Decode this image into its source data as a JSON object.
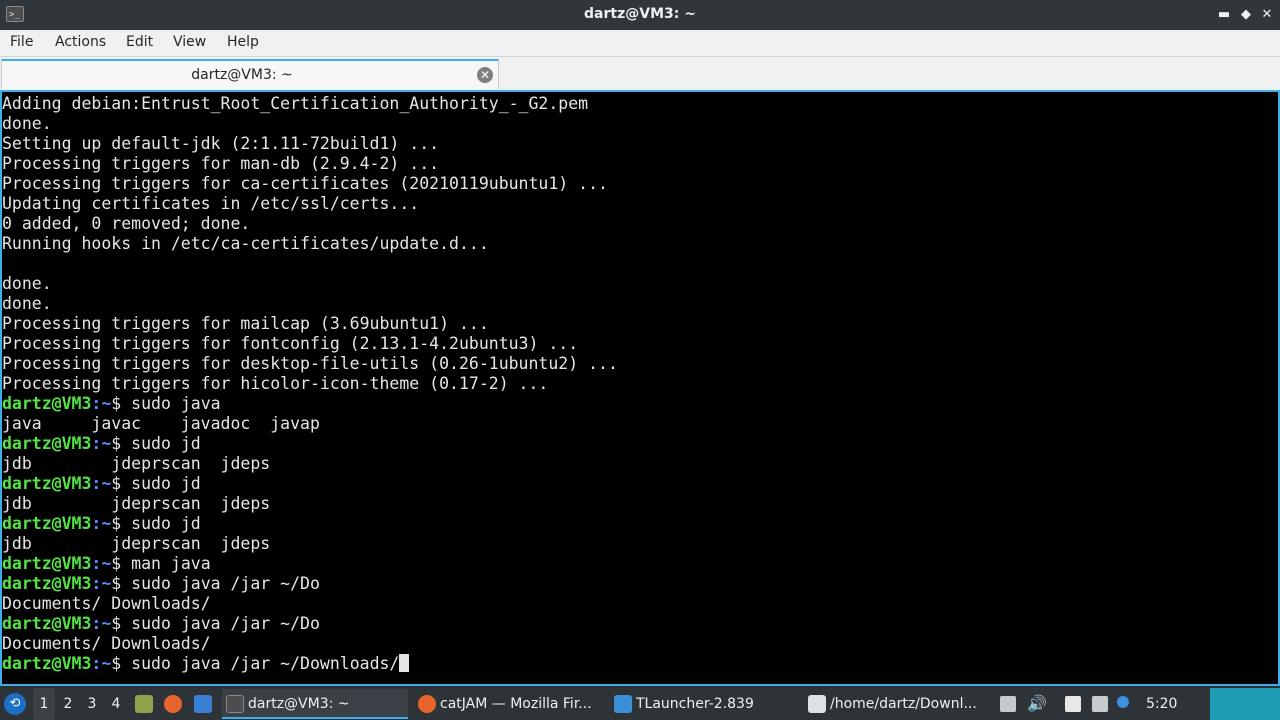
{
  "window": {
    "title": "dartz@VM3: ~",
    "app_icon": ">_",
    "minimize": "▬",
    "maximize": "◆",
    "close": "✕"
  },
  "menu": [
    "File",
    "Actions",
    "Edit",
    "View",
    "Help"
  ],
  "tab": {
    "label": "dartz@VM3: ~",
    "close": "✕"
  },
  "prompt": {
    "user_host": "dartz@VM3",
    "path": ":~",
    "symbol": "$ "
  },
  "terminal_lines": [
    {
      "type": "out",
      "text": "Adding debian:Entrust_Root_Certification_Authority_-_G2.pem"
    },
    {
      "type": "out",
      "text": "done."
    },
    {
      "type": "out",
      "text": "Setting up default-jdk (2:1.11-72build1) ..."
    },
    {
      "type": "out",
      "text": "Processing triggers for man-db (2.9.4-2) ..."
    },
    {
      "type": "out",
      "text": "Processing triggers for ca-certificates (20210119ubuntu1) ..."
    },
    {
      "type": "out",
      "text": "Updating certificates in /etc/ssl/certs..."
    },
    {
      "type": "out",
      "text": "0 added, 0 removed; done."
    },
    {
      "type": "out",
      "text": "Running hooks in /etc/ca-certificates/update.d..."
    },
    {
      "type": "out",
      "text": ""
    },
    {
      "type": "out",
      "text": "done."
    },
    {
      "type": "out",
      "text": "done."
    },
    {
      "type": "out",
      "text": "Processing triggers for mailcap (3.69ubuntu1) ..."
    },
    {
      "type": "out",
      "text": "Processing triggers for fontconfig (2.13.1-4.2ubuntu3) ..."
    },
    {
      "type": "out",
      "text": "Processing triggers for desktop-file-utils (0.26-1ubuntu2) ..."
    },
    {
      "type": "out",
      "text": "Processing triggers for hicolor-icon-theme (0.17-2) ..."
    },
    {
      "type": "cmd",
      "text": "sudo java"
    },
    {
      "type": "out",
      "text": "java     javac    javadoc  javap"
    },
    {
      "type": "cmd",
      "text": "sudo jd"
    },
    {
      "type": "out",
      "text": "jdb        jdeprscan  jdeps"
    },
    {
      "type": "cmd",
      "text": "sudo jd"
    },
    {
      "type": "out",
      "text": "jdb        jdeprscan  jdeps"
    },
    {
      "type": "cmd",
      "text": "sudo jd"
    },
    {
      "type": "out",
      "text": "jdb        jdeprscan  jdeps"
    },
    {
      "type": "cmd",
      "text": "man java"
    },
    {
      "type": "cmd",
      "text": "sudo java /jar ~/Do"
    },
    {
      "type": "out",
      "text": "Documents/ Downloads/"
    },
    {
      "type": "cmd",
      "text": "sudo java /jar ~/Do"
    },
    {
      "type": "out",
      "text": "Documents/ Downloads/"
    },
    {
      "type": "cmd",
      "text": "sudo java /jar ~/Downloads/",
      "cursor": true
    }
  ],
  "taskbar": {
    "workspaces": [
      "1",
      "2",
      "3",
      "4"
    ],
    "active_workspace": "1",
    "tasks": [
      {
        "label": "dartz@VM3: ~",
        "icon": "terminal-icon",
        "active": true
      },
      {
        "label": "catJAM — Mozilla Fir...",
        "icon": "firefox-icon",
        "active": false
      },
      {
        "label": "TLauncher-2.839",
        "icon": "folder-icon",
        "active": false
      },
      {
        "label": "/home/dartz/Downl...",
        "icon": "editor-icon",
        "active": false
      }
    ],
    "clock": "5:20"
  },
  "colors": {
    "accent": "#3daee9",
    "prompt_user": "#55e246",
    "prompt_path": "#5a8cff",
    "terminal_bg": "#000000",
    "panel_bg": "#2e3338"
  }
}
